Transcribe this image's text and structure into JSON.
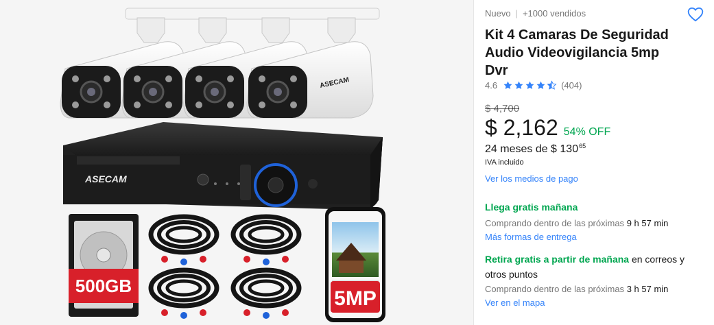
{
  "gallery": {
    "brand_label": "ASECAM",
    "hdd_label": "500GB",
    "resolution_label": "5MP"
  },
  "product": {
    "condition": "Nuevo",
    "separator": "|",
    "sold": "+1000 vendidos",
    "title": "Kit 4 Camaras De Seguridad Audio Videovigilancia 5mp Dvr",
    "rating": {
      "value": "4.6",
      "stars": 4.5,
      "count": "(404)"
    },
    "favorite_icon": "heart-outline-icon"
  },
  "price": {
    "original": "$ 4,700",
    "current": "$ 2,162",
    "discount": "54% OFF",
    "installments_text": "24 meses de $ 130",
    "installments_cents": "65",
    "tax_note": "IVA incluido",
    "payment_link": "Ver los medios de pago"
  },
  "shipping": {
    "title": "Llega gratis mañana",
    "subtitle_prefix": "Comprando dentro de las próximas",
    "subtitle_time": "9 h 57 min",
    "link": "Más formas de entrega"
  },
  "pickup": {
    "title_green": "Retira gratis a partir de mañana",
    "title_tail": "en correos y otros puntos",
    "subtitle_prefix": "Comprando dentro de las próximas",
    "subtitle_time": "3 h 57 min",
    "link": "Ver en el mapa"
  },
  "colors": {
    "accent_blue": "#3483fa",
    "success_green": "#00a650"
  }
}
